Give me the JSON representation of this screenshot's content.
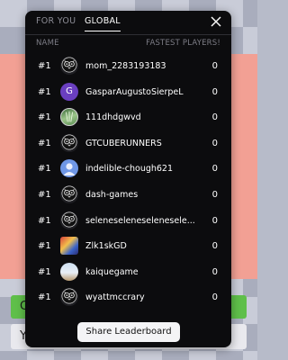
{
  "background": {
    "green_strip_letter": "C",
    "white_strip_letter": "Y"
  },
  "modal": {
    "tabs": [
      {
        "label": "FOR YOU",
        "active": false
      },
      {
        "label": "GLOBAL",
        "active": true
      }
    ],
    "close_icon": "close-icon",
    "columns": {
      "name": "NAME",
      "fastest": "FASTEST PLAYERS!"
    },
    "rows": [
      {
        "rank": "#1",
        "name": "mom_2283193183",
        "score": "0",
        "avatar": "owl-logo"
      },
      {
        "rank": "#1",
        "name": "GasparAugustoSierpeL",
        "score": "0",
        "avatar": "letter-G",
        "avatar_letter": "G",
        "avatar_color": "#6a3fc0"
      },
      {
        "rank": "#1",
        "name": "111dhdgwvd",
        "score": "0",
        "avatar": "green-photo"
      },
      {
        "rank": "#1",
        "name": "GTCUBERUNNERS",
        "score": "0",
        "avatar": "owl-logo"
      },
      {
        "rank": "#1",
        "name": "indelible-chough621",
        "score": "0",
        "avatar": "person-blue"
      },
      {
        "rank": "#1",
        "name": "dash-games",
        "score": "0",
        "avatar": "owl-logo"
      },
      {
        "rank": "#1",
        "name": "seleneseleneseleneseleneselene",
        "score": "0",
        "avatar": "owl-logo"
      },
      {
        "rank": "#1",
        "name": "Zlk1skGD",
        "score": "0",
        "avatar": "game-photo"
      },
      {
        "rank": "#1",
        "name": "kaiquegame",
        "score": "0",
        "avatar": "room-photo"
      },
      {
        "rank": "#1",
        "name": "wyattmccrary",
        "score": "0",
        "avatar": "owl-logo"
      }
    ],
    "share_label": "Share Leaderboard"
  }
}
